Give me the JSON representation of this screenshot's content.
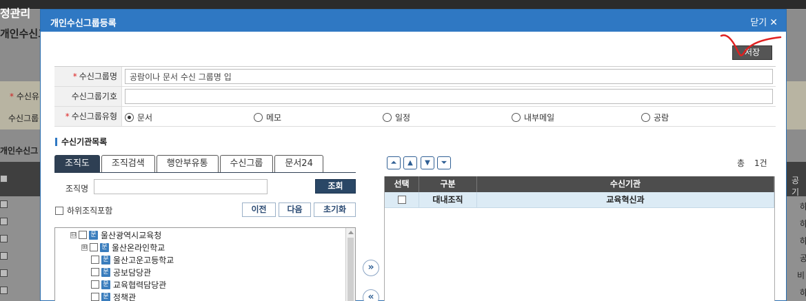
{
  "background": {
    "brand": "정관리",
    "page_title": "개인수신그",
    "form_label_1": "수신유",
    "form_label_2": "수신그룹",
    "list_title": "개인수신그",
    "right_cells": [
      "공기",
      "하",
      "하",
      "하",
      "공",
      "비",
      "하"
    ]
  },
  "modal": {
    "title": "개인수신그룹등록",
    "close_label": "닫기",
    "save_label": "저장"
  },
  "form": {
    "group_name_label": "수신그룹명",
    "group_name_value": "공람이나 문서 수신 그룹명 입",
    "group_code_label": "수신그룹기호",
    "group_code_value": "",
    "group_type_label": "수신그룹유형",
    "types": [
      {
        "label": "문서",
        "checked": true
      },
      {
        "label": "메모",
        "checked": false
      },
      {
        "label": "일정",
        "checked": false
      },
      {
        "label": "내부메일",
        "checked": false
      },
      {
        "label": "공람",
        "checked": false
      }
    ]
  },
  "section_title": "수신기관목록",
  "tabs": [
    "조직도",
    "조직검색",
    "행안부유통",
    "수신그룹",
    "문서24"
  ],
  "search": {
    "org_label": "조직명",
    "org_value": "",
    "search_button": "조회",
    "sub_org_label": "하위조직포함",
    "prev_button": "이전",
    "next_button": "다음",
    "reset_button": "초기화"
  },
  "tree": [
    {
      "label": "울산광역시교육청",
      "icon": "문",
      "expander": "⊟"
    },
    {
      "label": "울산온라인학교",
      "icon": "문",
      "expander": "⊞"
    },
    {
      "label": "울산고운고등학교",
      "icon": "문",
      "expander": ""
    },
    {
      "label": "공보담당관",
      "icon": "문",
      "expander": ""
    },
    {
      "label": "교육협력담당관",
      "icon": "문",
      "expander": ""
    },
    {
      "label": "정책관",
      "icon": "문",
      "expander": ""
    }
  ],
  "move": {
    "add": "»",
    "remove": "«"
  },
  "order_buttons": [
    "⏶",
    "▲",
    "▼",
    "⏷"
  ],
  "total": {
    "label": "총",
    "count": "1건"
  },
  "grid": {
    "headers": [
      "선택",
      "구분",
      "수신기관"
    ],
    "rows": [
      {
        "type": "대내조직",
        "org": "교육혁신과"
      }
    ]
  }
}
